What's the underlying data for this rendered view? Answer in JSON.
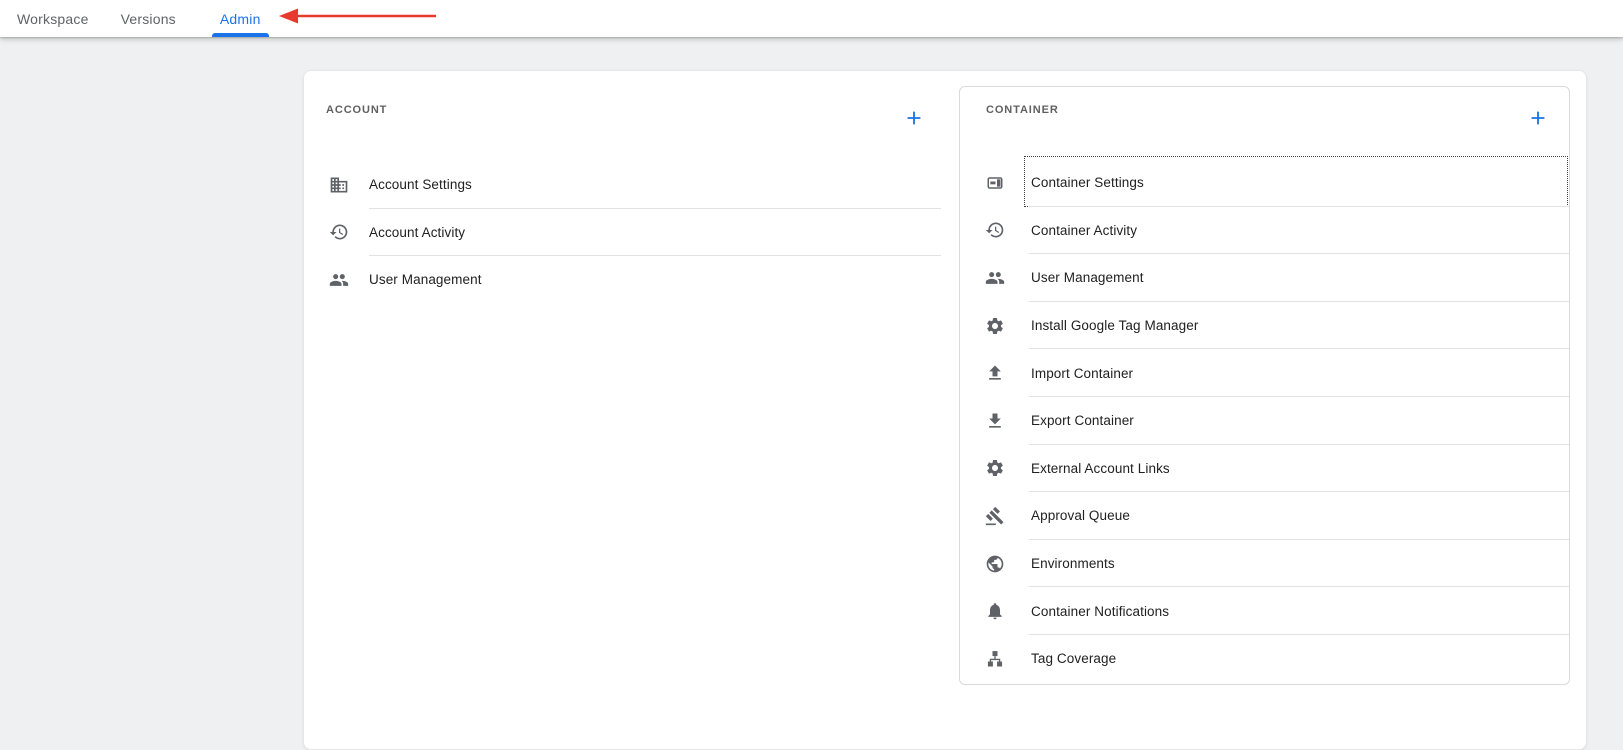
{
  "nav": {
    "tabs": [
      {
        "label": "Workspace",
        "active": false
      },
      {
        "label": "Versions",
        "active": false
      },
      {
        "label": "Admin",
        "active": true
      }
    ]
  },
  "annotation": {
    "type": "arrow-pointing-left-at-admin-tab",
    "color": "#e8392f"
  },
  "colors": {
    "accent_blue": "#1a73e8",
    "icon_gray": "#5f6368",
    "background": "#eef0f1"
  },
  "account": {
    "section_label": "ACCOUNT",
    "add_tooltip": "add",
    "items": [
      {
        "label": "Account Settings",
        "icon": "building-icon"
      },
      {
        "label": "Account Activity",
        "icon": "history-icon"
      },
      {
        "label": "User Management",
        "icon": "people-icon"
      }
    ]
  },
  "container": {
    "section_label": "CONTAINER",
    "add_tooltip": "add",
    "items": [
      {
        "label": "Container Settings",
        "icon": "container-icon",
        "focused": true
      },
      {
        "label": "Container Activity",
        "icon": "history-icon"
      },
      {
        "label": "User Management",
        "icon": "people-icon"
      },
      {
        "label": "Install Google Tag Manager",
        "icon": "gear-icon"
      },
      {
        "label": "Import Container",
        "icon": "upload-icon"
      },
      {
        "label": "Export Container",
        "icon": "download-icon"
      },
      {
        "label": "External Account Links",
        "icon": "gear-icon"
      },
      {
        "label": "Approval Queue",
        "icon": "gavel-icon"
      },
      {
        "label": "Environments",
        "icon": "globe-icon"
      },
      {
        "label": "Container Notifications",
        "icon": "bell-icon"
      },
      {
        "label": "Tag Coverage",
        "icon": "tree-icon"
      }
    ]
  }
}
